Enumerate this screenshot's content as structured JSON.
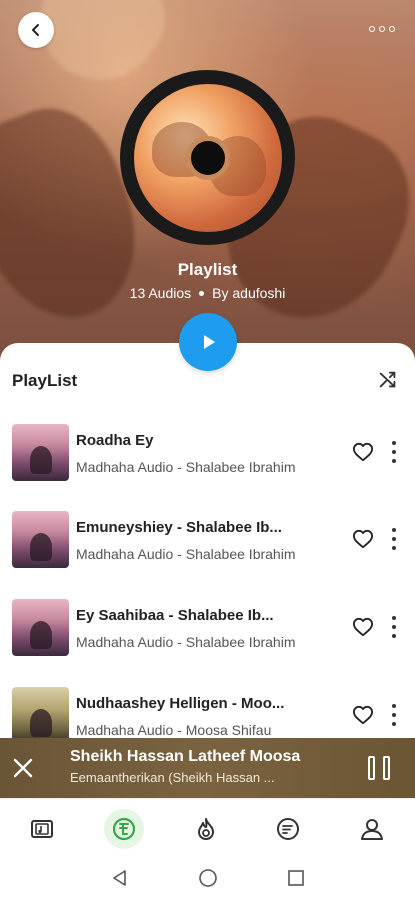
{
  "header": {
    "title": "Playlist",
    "count": "13 Audios",
    "author": "By adufoshi"
  },
  "sheet": {
    "title": "PlayList"
  },
  "tracks": [
    {
      "title": "Roadha Ey",
      "subtitle": "Madhaha Audio - Shalabee Ibrahim"
    },
    {
      "title": "Emuneyshiey - Shalabee Ib...",
      "subtitle": "Madhaha Audio - Shalabee Ibrahim"
    },
    {
      "title": "Ey Saahibaa - Shalabee Ib...",
      "subtitle": "Madhaha Audio - Shalabee Ibrahim"
    },
    {
      "title": "Nudhaashey Helligen - Moo...",
      "subtitle": "Madhaha Audio - Moosa Shifau"
    }
  ],
  "now_playing": {
    "title": "Sheikh Hassan Latheef Moosa",
    "subtitle": "Eemaantherikan (Sheikh Hassan ..."
  },
  "icons": {
    "back": "chevron-left-icon",
    "more": "more-horizontal-icon",
    "play": "play-icon",
    "shuffle": "shuffle-icon",
    "heart": "heart-outline-icon",
    "kebab": "more-vertical-icon",
    "close": "close-icon",
    "pause": "pause-icon"
  },
  "colors": {
    "accent": "#1e9cf0",
    "mini_player": "#6a5537",
    "nav_active": "#3aa64a"
  }
}
